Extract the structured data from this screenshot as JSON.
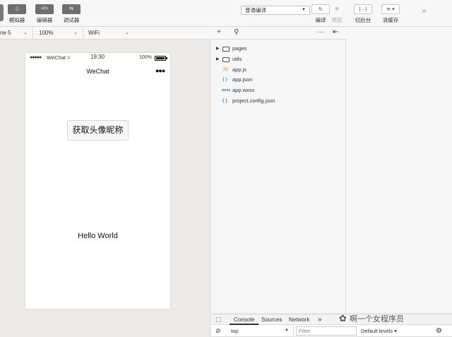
{
  "toolbar": {
    "simulator_label": "模拟器",
    "editor_label": "编辑器",
    "debugger_label": "调试器",
    "editor_icon_text": "</>",
    "compile_mode": "普通编译",
    "compile_label": "编译",
    "preview_label": "预览",
    "background_label": "切后台",
    "clear_cache_label": "清缓存"
  },
  "device_bar": {
    "device": "ne 5",
    "zoom": "100%",
    "network": "WiFi"
  },
  "phone": {
    "signal": "●●●●●",
    "carrier": "WeChat",
    "time": "19:30",
    "battery_pct": "100%",
    "battery_level": 1.0,
    "nav_title": "WeChat",
    "menu": "●●●",
    "button_text": "获取头像昵称",
    "hello_text": "Hello World"
  },
  "editor": {
    "add_icon": "+",
    "search_icon": "⚲",
    "more_icon": "···",
    "collapse_icon": "⇤",
    "tree": [
      {
        "name": "pages",
        "kind": "folder"
      },
      {
        "name": "utils",
        "kind": "folder"
      },
      {
        "name": "app.js",
        "kind": "js",
        "badge": "JS",
        "color": "#e6b422"
      },
      {
        "name": "app.json",
        "kind": "json",
        "badge": "{ }",
        "color": "#2f8dd6"
      },
      {
        "name": "app.wxss",
        "kind": "wxss",
        "badge": "wxss",
        "color": "#2f6fd6"
      },
      {
        "name": "project.config.json",
        "kind": "json",
        "badge": "{ }",
        "color": "#2f8dd6"
      }
    ]
  },
  "console": {
    "tabs": [
      "Console",
      "Sources",
      "Network"
    ],
    "more_tabs": "»",
    "context": "top",
    "filter_placeholder": "Filter",
    "levels": "Default levels"
  },
  "watermark": "啊一个女程序员"
}
